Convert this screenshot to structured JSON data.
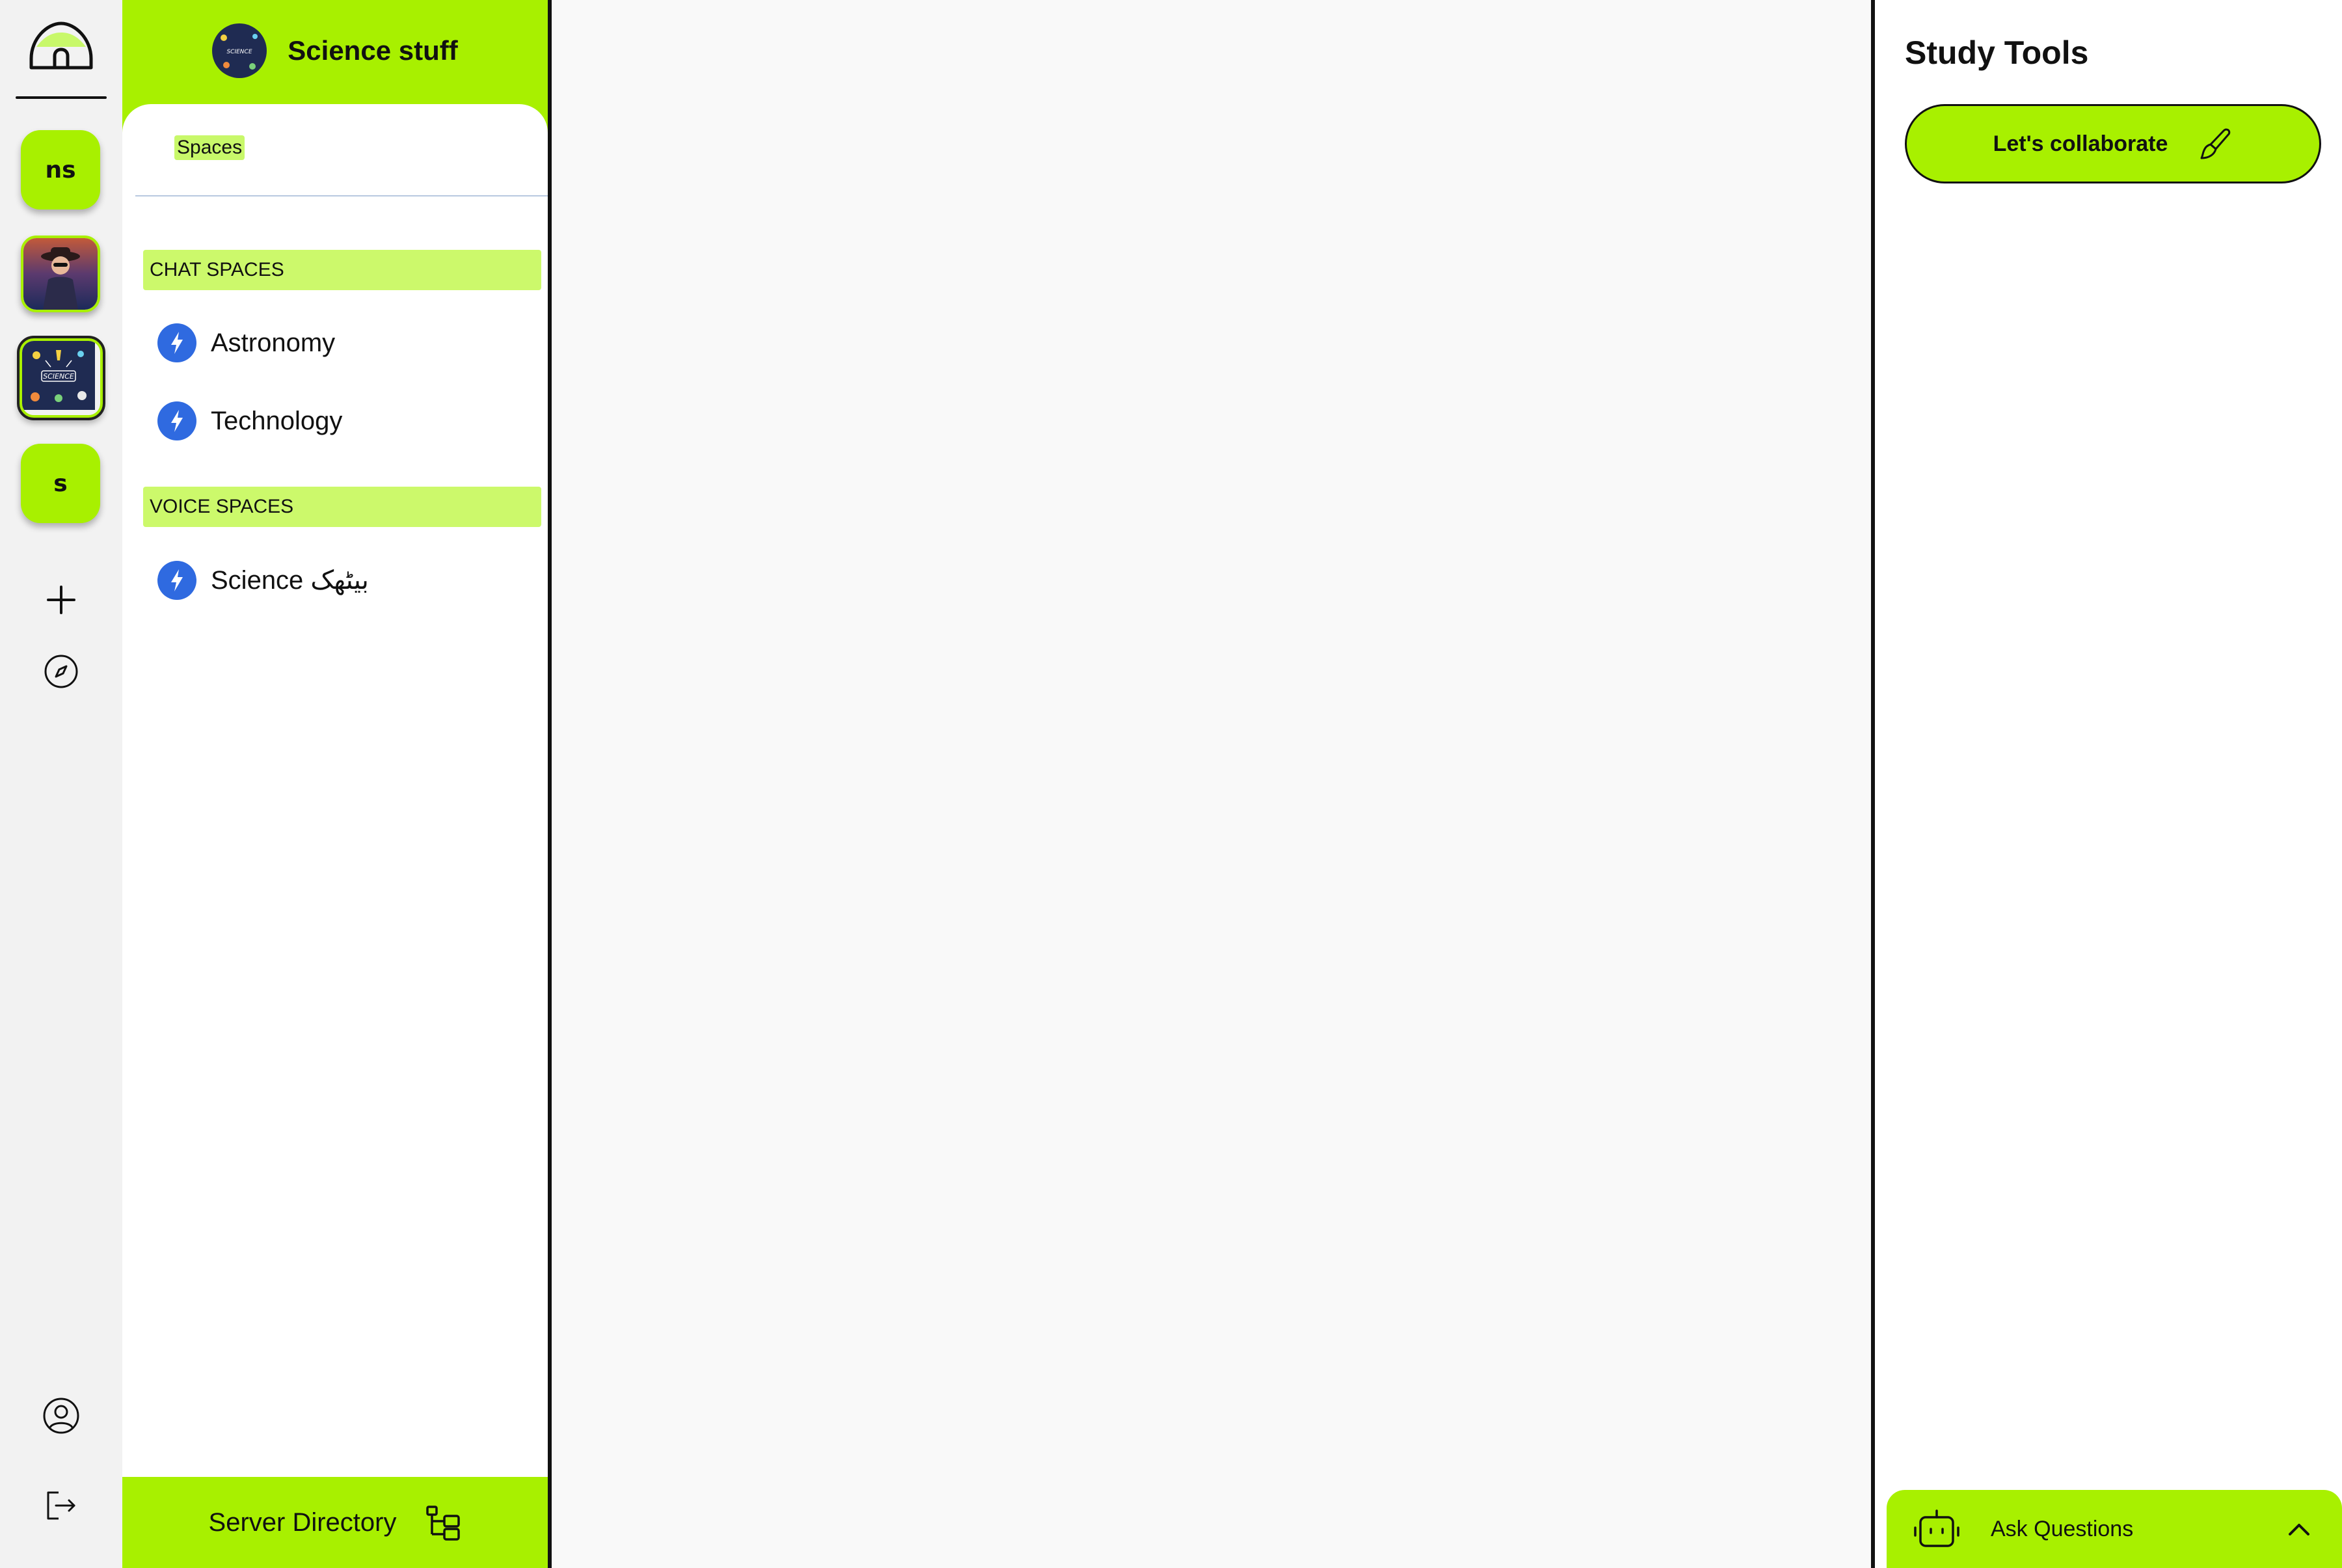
{
  "rail": {
    "servers": [
      {
        "type": "text",
        "label": "ns"
      },
      {
        "type": "image",
        "name": "avatar-person"
      },
      {
        "type": "image",
        "name": "science-server",
        "active": true
      },
      {
        "type": "text",
        "label": "s"
      }
    ],
    "icons": [
      "home-icon",
      "add-server-icon",
      "explore-icon",
      "profile-icon",
      "logout-icon"
    ]
  },
  "server": {
    "name": "Science stuff",
    "tab": "Spaces",
    "sections": [
      {
        "title": "CHAT SPACES",
        "channels": [
          "Astronomy",
          "Technology"
        ]
      },
      {
        "title": "VOICE SPACES",
        "channels": [
          "Science بیٹھک"
        ]
      }
    ],
    "footer": "Server Directory"
  },
  "tools": {
    "title": "Study Tools",
    "collaborate": "Let's collaborate",
    "ask": "Ask Questions"
  },
  "colors": {
    "accent": "#a8f000",
    "section": "#ccf96b",
    "bolt": "#2f6ae0",
    "border": "#111111"
  }
}
